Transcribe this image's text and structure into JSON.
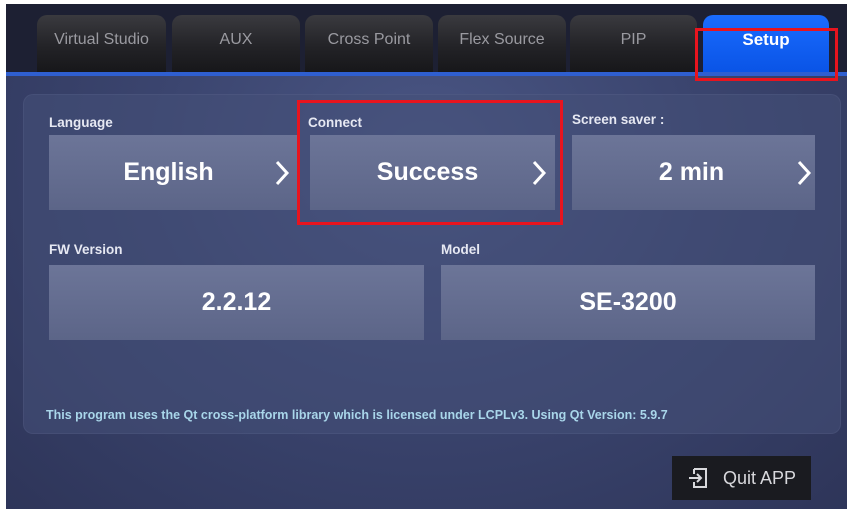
{
  "tabs": [
    {
      "label": "Virtual Studio",
      "active": false
    },
    {
      "label": "AUX",
      "active": false
    },
    {
      "label": "Cross Point",
      "active": false
    },
    {
      "label": "Flex Source",
      "active": false
    },
    {
      "label": "PIP",
      "active": false
    },
    {
      "label": "Setup",
      "active": true
    }
  ],
  "setup": {
    "language": {
      "label": "Language",
      "value": "English"
    },
    "connect": {
      "label": "Connect",
      "value": "Success"
    },
    "screen_saver": {
      "label": "Screen saver :",
      "value": "2 min"
    },
    "fw_version": {
      "label": "FW Version",
      "value": "2.2.12"
    },
    "model": {
      "label": "Model",
      "value": "SE-3200"
    }
  },
  "footer": {
    "license_text": "This program uses the Qt cross-platform library which is licensed under LCPLv3. Using Qt Version: 5.9.7",
    "quit_label": "Quit APP"
  },
  "colors": {
    "active_tab": "#0a54e6",
    "highlight": "#e8141e",
    "field_bg": "#6c7598"
  }
}
